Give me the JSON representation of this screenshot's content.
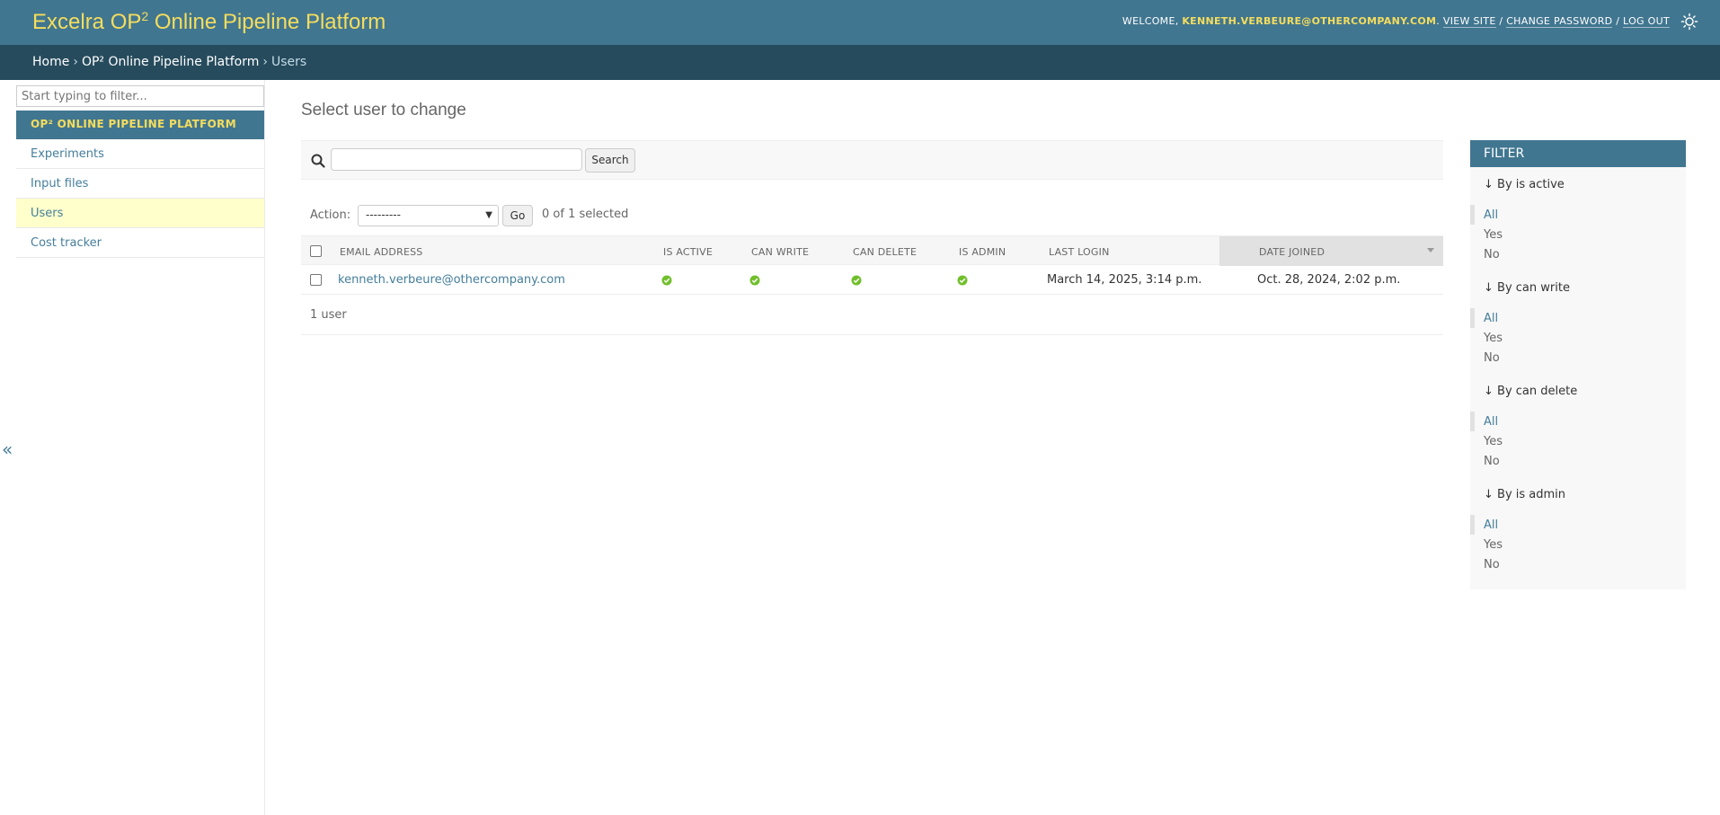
{
  "header": {
    "brand_prefix": "Excelra OP",
    "brand_sup": "2",
    "brand_suffix": " Online Pipeline Platform",
    "welcome": "Welcome,",
    "username": "kenneth.verbeure@othercompany.com",
    "view_site": "View site",
    "change_password": "Change password",
    "log_out": "Log out",
    "theme_icon": "sun-icon"
  },
  "breadcrumbs": {
    "home": "Home",
    "app": "OP² Online Pipeline Platform",
    "current": "Users"
  },
  "sidebar": {
    "filter_placeholder": "Start typing to filter...",
    "app_caption": "OP² Online Pipeline Platform",
    "items": [
      {
        "label": "Experiments",
        "active": false
      },
      {
        "label": "Input files",
        "active": false
      },
      {
        "label": "Users",
        "active": true
      },
      {
        "label": "Cost tracker",
        "active": false
      }
    ],
    "collapse_label": "«"
  },
  "main": {
    "title": "Select user to change",
    "search_button": "Search",
    "search_value": "",
    "action_label": "Action:",
    "action_selected": "---------",
    "go_button": "Go",
    "counter": "0 of 1 selected",
    "columns": [
      "Email address",
      "Is active",
      "Can write",
      "Can delete",
      "Is admin",
      "Last login",
      "Date joined"
    ],
    "sorted_column": "Date joined",
    "rows": [
      {
        "email": "kenneth.verbeure@othercompany.com",
        "is_active": true,
        "can_write": true,
        "can_delete": true,
        "is_admin": true,
        "last_login": "March 14, 2025, 3:14 p.m.",
        "date_joined": "Oct. 28, 2024, 2:02 p.m."
      }
    ],
    "paginator": "1 user"
  },
  "filter": {
    "title": "Filter",
    "sections": [
      {
        "title": "↓ By is active",
        "options": [
          "All",
          "Yes",
          "No"
        ],
        "selected": "All"
      },
      {
        "title": "↓ By can write",
        "options": [
          "All",
          "Yes",
          "No"
        ],
        "selected": "All"
      },
      {
        "title": "↓ By can delete",
        "options": [
          "All",
          "Yes",
          "No"
        ],
        "selected": "All"
      },
      {
        "title": "↓ By is admin",
        "options": [
          "All",
          "Yes",
          "No"
        ],
        "selected": "All"
      }
    ]
  },
  "colors": {
    "header_bg": "#417690",
    "breadcrumb_bg": "#264b5d",
    "brand_yellow": "#f5dd5d",
    "link": "#447e9b",
    "active_row": "#ffffcc",
    "bool_yes": "#70bf2b"
  }
}
